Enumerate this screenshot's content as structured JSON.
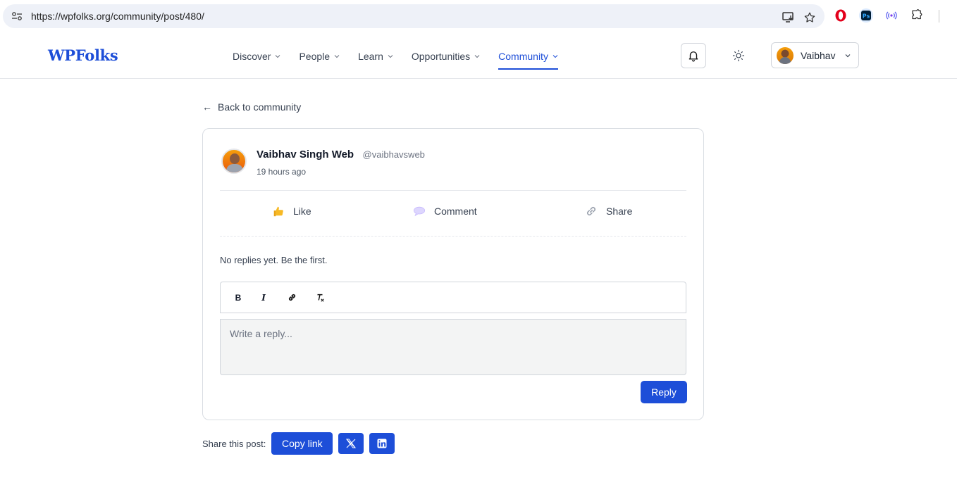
{
  "browser": {
    "url": "https://wpfolks.org/community/post/480/",
    "icons": [
      "site-info-icon",
      "install-app-icon",
      "bookmark-star-icon",
      "opera-extension-icon",
      "photoshop-extension-icon",
      "broadcast-extension-icon",
      "extensions-puzzle-icon"
    ]
  },
  "header": {
    "logo": "WPFolks",
    "nav": [
      {
        "label": "Discover",
        "active": false
      },
      {
        "label": "People",
        "active": false
      },
      {
        "label": "Learn",
        "active": false
      },
      {
        "label": "Opportunities",
        "active": false
      },
      {
        "label": "Community",
        "active": true
      }
    ],
    "user_name": "Vaibhav"
  },
  "back_link": "Back to community",
  "post": {
    "author_name": "Vaibhav Singh Web",
    "author_handle": "@vaibhavsweb",
    "time": "19 hours ago",
    "actions": {
      "like": "Like",
      "comment": "Comment",
      "share": "Share"
    },
    "no_replies": "No replies yet. Be the first.",
    "reply_placeholder": "Write a reply...",
    "toolbar": {
      "bold": "B",
      "italic": "I"
    },
    "reply_button": "Reply"
  },
  "share": {
    "label": "Share this post:",
    "copy_link": "Copy link"
  },
  "colors": {
    "accent": "#1d4ed8",
    "editor_bg": "#f3f4f4"
  }
}
